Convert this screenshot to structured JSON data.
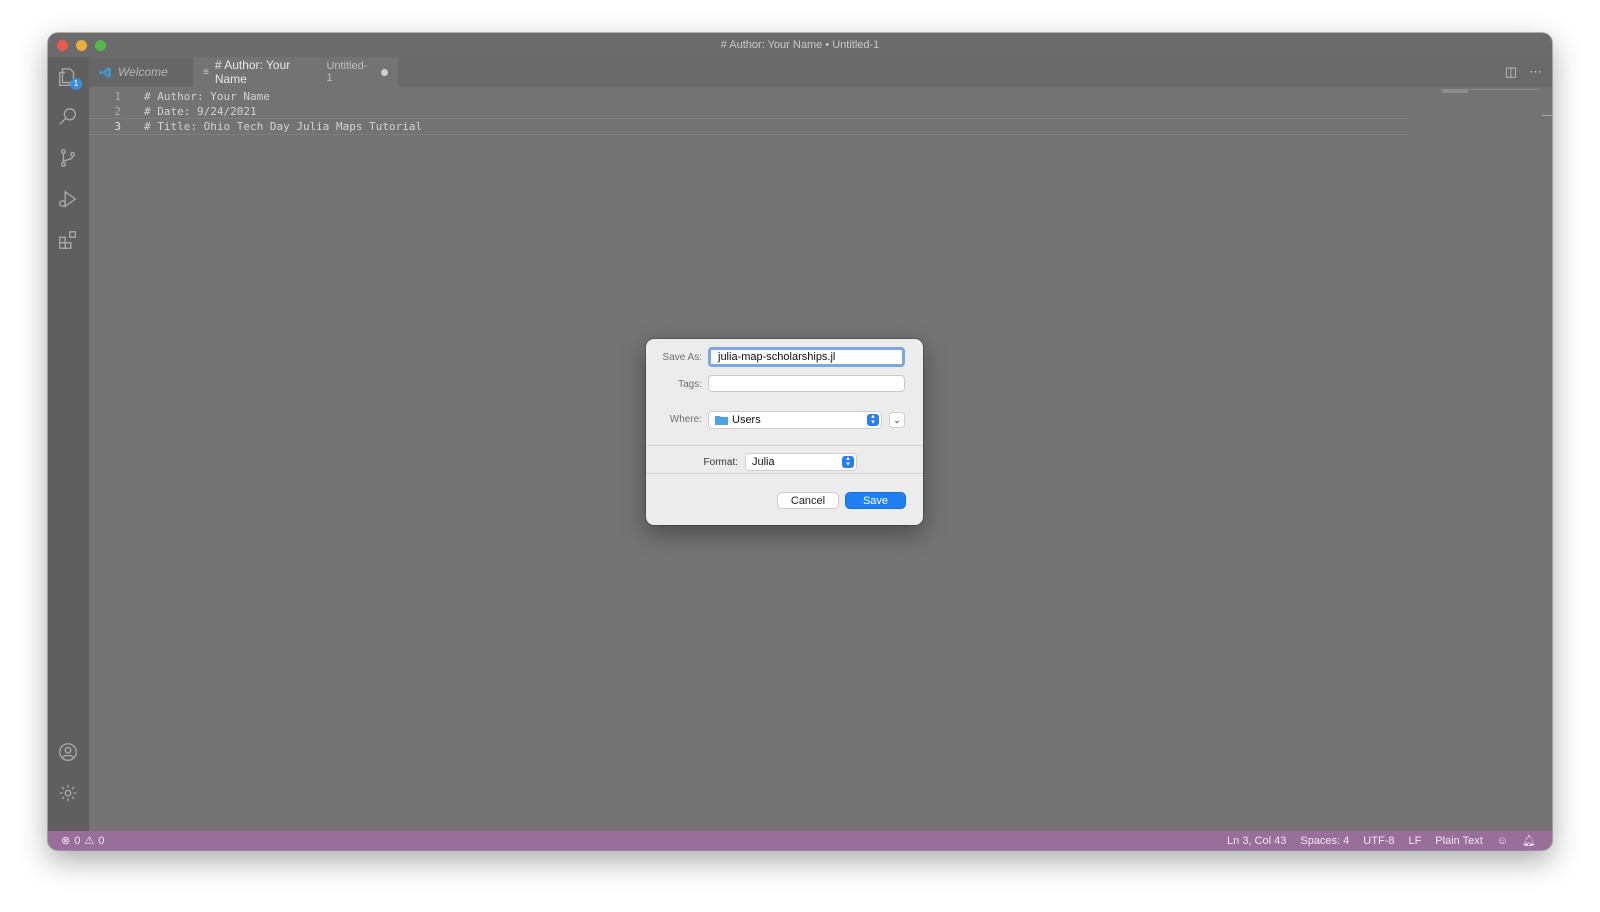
{
  "window": {
    "title": "# Author: Your Name • Untitled-1"
  },
  "activity_bar": {
    "items": [
      {
        "name": "explorer-icon",
        "badge": "1"
      },
      {
        "name": "search-icon"
      },
      {
        "name": "source-control-icon"
      },
      {
        "name": "run-debug-icon"
      },
      {
        "name": "extensions-icon"
      }
    ],
    "bottom": [
      {
        "name": "account-icon"
      },
      {
        "name": "settings-gear-icon"
      }
    ]
  },
  "tabs": {
    "welcome": "Welcome",
    "active_title": "# Author: Your Name",
    "active_subtitle": "Untitled-1"
  },
  "editor": {
    "lines": [
      {
        "number": "1",
        "text": "# Author: Your Name"
      },
      {
        "number": "2",
        "text": "# Date: 9/24/2021"
      },
      {
        "number": "3",
        "text": "# Title: Ohio Tech Day Julia Maps Tutorial"
      }
    ]
  },
  "dialog": {
    "save_as_label": "Save As:",
    "save_as_value": "julia-map-scholarships.jl",
    "tags_label": "Tags:",
    "tags_value": "",
    "where_label": "Where:",
    "where_value": "Users",
    "format_label": "Format:",
    "format_value": "Julia",
    "cancel_label": "Cancel",
    "save_label": "Save"
  },
  "status_bar": {
    "errors": "0",
    "warnings": "0",
    "position": "Ln 3, Col 43",
    "spaces": "Spaces: 4",
    "encoding": "UTF-8",
    "eol": "LF",
    "language": "Plain Text"
  },
  "colors": {
    "status_bar": "#9a6e9a",
    "accent": "#1f7ff3"
  }
}
